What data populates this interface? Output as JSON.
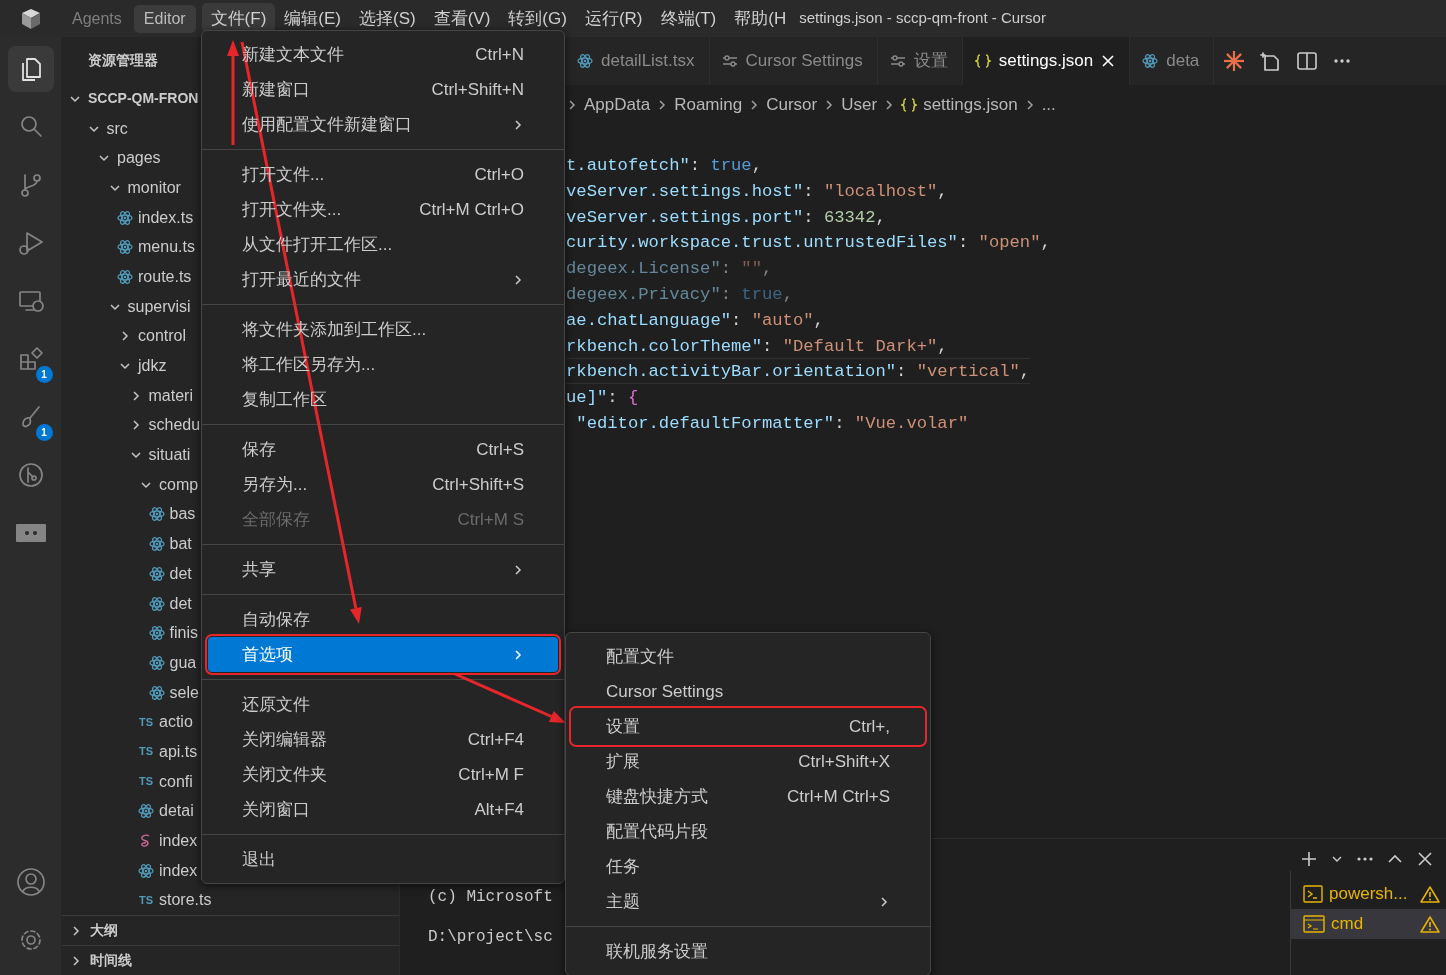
{
  "title_bar": {
    "mode_tabs": [
      {
        "label": "Agents",
        "selected": false
      },
      {
        "label": "Editor",
        "selected": true
      }
    ],
    "menus": [
      {
        "label": "文件(F)",
        "selected": true
      },
      {
        "label": "编辑(E)",
        "selected": false
      },
      {
        "label": "选择(S)",
        "selected": false
      },
      {
        "label": "查看(V)",
        "selected": false
      },
      {
        "label": "转到(G)",
        "selected": false
      },
      {
        "label": "运行(R)",
        "selected": false
      },
      {
        "label": "终端(T)",
        "selected": false
      },
      {
        "label": "帮助(H",
        "selected": false
      }
    ],
    "title": "settings.json - sccp-qm-front - Cursor"
  },
  "activity_bar": {
    "items": [
      {
        "kind": "files",
        "selected": true
      },
      {
        "kind": "search",
        "selected": false
      },
      {
        "kind": "source-control",
        "selected": false
      },
      {
        "kind": "run-debug",
        "selected": false
      },
      {
        "kind": "remote",
        "selected": false
      },
      {
        "kind": "extensions",
        "selected": false,
        "badge": "1"
      },
      {
        "kind": "brush",
        "selected": false,
        "badge": "1"
      },
      {
        "kind": "git-graph",
        "selected": false
      },
      {
        "kind": "board",
        "selected": false
      }
    ],
    "bottom": [
      {
        "kind": "account"
      },
      {
        "kind": "settings"
      }
    ]
  },
  "sidebar": {
    "title": "资源管理器",
    "tree": [
      {
        "label": "SCCP-QM-FRON",
        "kind": "root",
        "expanded": true,
        "children": [
          {
            "label": "src",
            "kind": "folder",
            "expanded": true,
            "children": [
              {
                "label": "pages",
                "kind": "folder",
                "expanded": true,
                "children": [
                  {
                    "label": "monitor",
                    "kind": "folder",
                    "expanded": true,
                    "children": [
                      {
                        "label": "index.ts",
                        "kind": "react"
                      },
                      {
                        "label": "menu.ts",
                        "kind": "react"
                      },
                      {
                        "label": "route.ts",
                        "kind": "react"
                      }
                    ]
                  },
                  {
                    "label": "supervisi",
                    "kind": "folder",
                    "expanded": true,
                    "children": [
                      {
                        "label": "control",
                        "kind": "folder",
                        "expanded": false
                      },
                      {
                        "label": "jdkz",
                        "kind": "folder",
                        "expanded": true,
                        "children": [
                          {
                            "label": "materi",
                            "kind": "folder",
                            "expanded": false
                          },
                          {
                            "label": "schedu",
                            "kind": "folder",
                            "expanded": false
                          },
                          {
                            "label": "situati",
                            "kind": "folder",
                            "expanded": true,
                            "children": [
                              {
                                "label": "comp",
                                "kind": "folder",
                                "expanded": true,
                                "children": [
                                  {
                                    "label": "bas",
                                    "kind": "react"
                                  },
                                  {
                                    "label": "bat",
                                    "kind": "react"
                                  },
                                  {
                                    "label": "det",
                                    "kind": "react"
                                  },
                                  {
                                    "label": "det",
                                    "kind": "react"
                                  },
                                  {
                                    "label": "finis",
                                    "kind": "react"
                                  },
                                  {
                                    "label": "gua",
                                    "kind": "react"
                                  },
                                  {
                                    "label": "sele",
                                    "kind": "react"
                                  }
                                ]
                              },
                              {
                                "label": "actio",
                                "kind": "ts",
                                "icon_label": "TS"
                              },
                              {
                                "label": "api.ts",
                                "kind": "ts",
                                "icon_label": "TS"
                              },
                              {
                                "label": "confi",
                                "kind": "ts",
                                "icon_label": "TS"
                              },
                              {
                                "label": "detai",
                                "kind": "react"
                              },
                              {
                                "label": "index",
                                "kind": "sass"
                              },
                              {
                                "label": "index",
                                "kind": "react"
                              },
                              {
                                "label": "store.ts",
                                "kind": "ts",
                                "icon_label": "TS"
                              }
                            ]
                          }
                        ]
                      }
                    ]
                  }
                ]
              }
            ]
          }
        ]
      }
    ],
    "sections": [
      {
        "label": "大纲",
        "expanded": false
      },
      {
        "label": "时间线",
        "expanded": false
      }
    ]
  },
  "file_menu": {
    "items": [
      {
        "kind": "item",
        "label": "新建文本文件",
        "shortcut": "Ctrl+N",
        "submenu": false,
        "disabled": false,
        "selected": false,
        "highlighted": false
      },
      {
        "kind": "item",
        "label": "新建窗口",
        "shortcut": "Ctrl+Shift+N",
        "submenu": false,
        "disabled": false,
        "selected": false,
        "highlighted": false
      },
      {
        "kind": "item",
        "label": "使用配置文件新建窗口",
        "submenu": true,
        "disabled": false,
        "selected": false,
        "highlighted": false
      },
      {
        "kind": "separator"
      },
      {
        "kind": "item",
        "label": "打开文件...",
        "shortcut": "Ctrl+O",
        "submenu": false,
        "disabled": false,
        "selected": false,
        "highlighted": false
      },
      {
        "kind": "item",
        "label": "打开文件夹...",
        "shortcut": "Ctrl+M Ctrl+O",
        "submenu": false,
        "disabled": false,
        "selected": false,
        "highlighted": false
      },
      {
        "kind": "item",
        "label": "从文件打开工作区...",
        "submenu": false,
        "disabled": false,
        "selected": false,
        "highlighted": false
      },
      {
        "kind": "item",
        "label": "打开最近的文件",
        "submenu": true,
        "disabled": false,
        "selected": false,
        "highlighted": false
      },
      {
        "kind": "separator"
      },
      {
        "kind": "item",
        "label": "将文件夹添加到工作区...",
        "submenu": false,
        "disabled": false,
        "selected": false,
        "highlighted": false
      },
      {
        "kind": "item",
        "label": "将工作区另存为...",
        "submenu": false,
        "disabled": false,
        "selected": false,
        "highlighted": false
      },
      {
        "kind": "item",
        "label": "复制工作区",
        "submenu": false,
        "disabled": false,
        "selected": false,
        "highlighted": false
      },
      {
        "kind": "separator"
      },
      {
        "kind": "item",
        "label": "保存",
        "shortcut": "Ctrl+S",
        "submenu": false,
        "disabled": false,
        "selected": false,
        "highlighted": false
      },
      {
        "kind": "item",
        "label": "另存为...",
        "shortcut": "Ctrl+Shift+S",
        "submenu": false,
        "disabled": false,
        "selected": false,
        "highlighted": false
      },
      {
        "kind": "item",
        "label": "全部保存",
        "shortcut": "Ctrl+M S",
        "submenu": false,
        "disabled": true,
        "selected": false,
        "highlighted": false
      },
      {
        "kind": "separator"
      },
      {
        "kind": "item",
        "label": "共享",
        "submenu": true,
        "disabled": false,
        "selected": false,
        "highlighted": false
      },
      {
        "kind": "separator"
      },
      {
        "kind": "item",
        "label": "自动保存",
        "submenu": false,
        "disabled": false,
        "selected": false,
        "highlighted": false
      },
      {
        "kind": "item",
        "label": "首选项",
        "submenu": true,
        "disabled": false,
        "selected": true,
        "highlighted": true
      },
      {
        "kind": "separator"
      },
      {
        "kind": "item",
        "label": "还原文件",
        "submenu": false,
        "disabled": false,
        "selected": false,
        "highlighted": false
      },
      {
        "kind": "item",
        "label": "关闭编辑器",
        "shortcut": "Ctrl+F4",
        "submenu": false,
        "disabled": false,
        "selected": false,
        "highlighted": false
      },
      {
        "kind": "item",
        "label": "关闭文件夹",
        "shortcut": "Ctrl+M F",
        "submenu": false,
        "disabled": false,
        "selected": false,
        "highlighted": false
      },
      {
        "kind": "item",
        "label": "关闭窗口",
        "shortcut": "Alt+F4",
        "submenu": false,
        "disabled": false,
        "selected": false,
        "highlighted": false
      },
      {
        "kind": "separator"
      },
      {
        "kind": "item",
        "label": "退出",
        "submenu": false,
        "disabled": false,
        "selected": false,
        "highlighted": false
      }
    ]
  },
  "preferences_menu": {
    "items": [
      {
        "kind": "item",
        "label": "配置文件",
        "submenu": false,
        "disabled": false,
        "selected": false,
        "highlighted": false
      },
      {
        "kind": "item",
        "label": "Cursor Settings",
        "submenu": false,
        "disabled": false,
        "selected": false,
        "highlighted": false
      },
      {
        "kind": "item",
        "label": "设置",
        "shortcut": "Ctrl+,",
        "submenu": false,
        "disabled": false,
        "selected": false,
        "highlighted": true
      },
      {
        "kind": "item",
        "label": "扩展",
        "shortcut": "Ctrl+Shift+X",
        "submenu": false,
        "disabled": false,
        "selected": false,
        "highlighted": false
      },
      {
        "kind": "item",
        "label": "键盘快捷方式",
        "shortcut": "Ctrl+M Ctrl+S",
        "submenu": false,
        "disabled": false,
        "selected": false,
        "highlighted": false
      },
      {
        "kind": "item",
        "label": "配置代码片段",
        "submenu": false,
        "disabled": false,
        "selected": false,
        "highlighted": false
      },
      {
        "kind": "item",
        "label": "任务",
        "submenu": false,
        "disabled": false,
        "selected": false,
        "highlighted": false
      },
      {
        "kind": "item",
        "label": "主题",
        "submenu": true,
        "disabled": false,
        "selected": false,
        "highlighted": false
      },
      {
        "kind": "separator"
      },
      {
        "kind": "item",
        "label": "联机服务设置",
        "submenu": false,
        "disabled": false,
        "selected": false,
        "highlighted": false
      }
    ]
  },
  "editor": {
    "tabs": [
      {
        "label": "detailList.tsx",
        "kind": "react",
        "selected": false
      },
      {
        "label": "Cursor Settings",
        "kind": "settings",
        "selected": false
      },
      {
        "label": "设置",
        "kind": "settings",
        "selected": false
      },
      {
        "label": "settings.json",
        "kind": "json",
        "selected": true
      },
      {
        "label": "deta",
        "kind": "react",
        "selected": false
      }
    ],
    "actions": [
      {
        "kind": "sparkle"
      },
      {
        "kind": "new-file"
      },
      {
        "kind": "split"
      },
      {
        "kind": "more"
      }
    ],
    "breadcrumb": [
      {
        "label": "AppData"
      },
      {
        "label": "Roaming"
      },
      {
        "label": "Cursor"
      },
      {
        "label": "User"
      },
      {
        "label": "settings.json",
        "kind": "json"
      },
      {
        "label": "..."
      }
    ],
    "lines": [
      {
        "dimmed": false,
        "current": false,
        "tokens": [
          {
            "text": "t.autofetch\"",
            "kind": "key"
          },
          {
            "text": ": ",
            "kind": "punct"
          },
          {
            "text": "true",
            "kind": "bool"
          },
          {
            "text": ",",
            "kind": "punct"
          }
        ]
      },
      {
        "dimmed": false,
        "current": false,
        "tokens": [
          {
            "text": "veServer.settings.host\"",
            "kind": "key"
          },
          {
            "text": ": ",
            "kind": "punct"
          },
          {
            "text": "\"localhost\"",
            "kind": "string"
          },
          {
            "text": ",",
            "kind": "punct"
          }
        ]
      },
      {
        "dimmed": false,
        "current": false,
        "tokens": [
          {
            "text": "veServer.settings.port\"",
            "kind": "key"
          },
          {
            "text": ": ",
            "kind": "punct"
          },
          {
            "text": "63342",
            "kind": "number"
          },
          {
            "text": ",",
            "kind": "punct"
          }
        ]
      },
      {
        "dimmed": false,
        "current": false,
        "tokens": [
          {
            "text": "curity.workspace.trust.untrustedFiles\"",
            "kind": "key"
          },
          {
            "text": ": ",
            "kind": "punct"
          },
          {
            "text": "\"open\"",
            "kind": "string"
          },
          {
            "text": ",",
            "kind": "punct"
          }
        ]
      },
      {
        "dimmed": true,
        "current": false,
        "tokens": [
          {
            "text": "degeex.License\"",
            "kind": "key"
          },
          {
            "text": ": ",
            "kind": "punct"
          },
          {
            "text": "\"\"",
            "kind": "string"
          },
          {
            "text": ",",
            "kind": "punct"
          }
        ]
      },
      {
        "dimmed": true,
        "current": false,
        "tokens": [
          {
            "text": "degeex.Privacy\"",
            "kind": "key"
          },
          {
            "text": ": ",
            "kind": "punct"
          },
          {
            "text": "true",
            "kind": "bool"
          },
          {
            "text": ",",
            "kind": "punct"
          }
        ]
      },
      {
        "dimmed": false,
        "current": false,
        "tokens": [
          {
            "text": "ae.chatLanguage\"",
            "kind": "key"
          },
          {
            "text": ": ",
            "kind": "punct"
          },
          {
            "text": "\"auto\"",
            "kind": "string"
          },
          {
            "text": ",",
            "kind": "punct"
          }
        ]
      },
      {
        "dimmed": false,
        "current": false,
        "tokens": [
          {
            "text": "rkbench.colorTheme\"",
            "kind": "key"
          },
          {
            "text": ": ",
            "kind": "punct"
          },
          {
            "text": "\"Default Dark+\"",
            "kind": "string"
          },
          {
            "text": ",",
            "kind": "punct"
          }
        ]
      },
      {
        "dimmed": false,
        "current": true,
        "tokens": [
          {
            "text": "rkbench.activityBar.orientation\"",
            "kind": "key"
          },
          {
            "text": ": ",
            "kind": "punct"
          },
          {
            "text": "\"vertical\"",
            "kind": "string"
          },
          {
            "text": ",",
            "kind": "punct"
          }
        ]
      },
      {
        "dimmed": false,
        "current": false,
        "tokens": [
          {
            "text": "ue]\"",
            "kind": "key"
          },
          {
            "text": ": ",
            "kind": "punct"
          },
          {
            "text": "{",
            "kind": "brace"
          }
        ]
      },
      {
        "dimmed": false,
        "current": false,
        "tokens": [
          {
            "text": " \"editor.defaultFormatter\"",
            "kind": "key"
          },
          {
            "text": ": ",
            "kind": "punct"
          },
          {
            "text": "\"Vue.volar\"",
            "kind": "string"
          }
        ]
      }
    ]
  },
  "panel": {
    "actions": [
      {
        "kind": "add"
      },
      {
        "kind": "dropdown"
      },
      {
        "kind": "more"
      },
      {
        "kind": "maximize"
      },
      {
        "kind": "close"
      }
    ],
    "terminal_lines": [
      "(c) Microsoft",
      "D:\\project\\sc"
    ],
    "terminals": [
      {
        "label": "powersh...",
        "kind": "powershell",
        "selected": false,
        "warning": true
      },
      {
        "label": "cmd",
        "kind": "cmd",
        "selected": true,
        "warning": true
      }
    ]
  }
}
